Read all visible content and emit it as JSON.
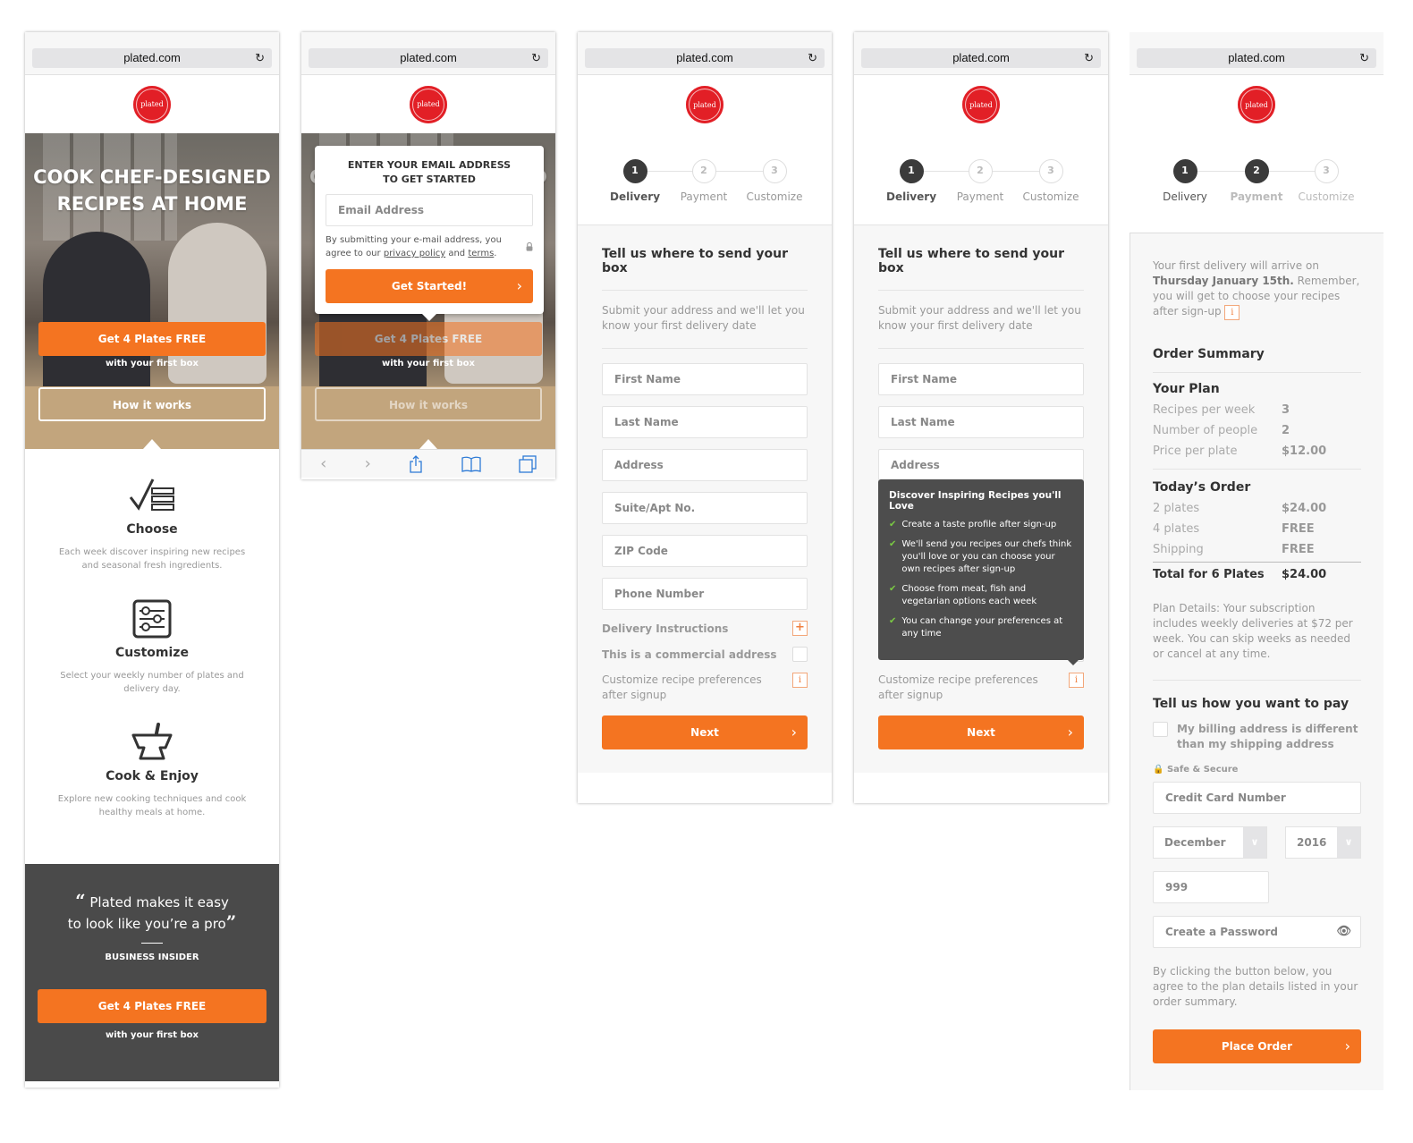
{
  "browser": {
    "url": "plated.com",
    "reload_icon": "↻"
  },
  "brand": {
    "logo_text": "plated",
    "accent": "#f47421",
    "logo_red": "#e21f26"
  },
  "landing": {
    "hero_title_line1": "COOK CHEF-DESIGNED",
    "hero_title_line2": "RECIPES AT HOME",
    "cta_label": "Get 4 Plates FREE",
    "cta_sub": "with your first box",
    "how_label": "How it works",
    "features": [
      {
        "title": "Choose",
        "desc": "Each week discover inspiring new recipes and seasonal fresh ingredients.",
        "icon": "checklist-icon"
      },
      {
        "title": "Customize",
        "desc": "Select your weekly number of plates and delivery day.",
        "icon": "sliders-icon"
      },
      {
        "title": "Cook & Enjoy",
        "desc": "Explore new cooking techniques and cook healthy meals at home.",
        "icon": "mortar-pestle-icon"
      }
    ],
    "quote_open": "“",
    "quote_line1": "Plated makes it easy",
    "quote_line2": "to look like you’re a pro",
    "quote_close": "”",
    "quote_source": "BUSINESS INSIDER",
    "footer_cta": "Get 4 Plates FREE",
    "footer_cta_sub": "with your first box"
  },
  "email_modal": {
    "heading_line1": "ENTER YOUR EMAIL ADDRESS",
    "heading_line2": "TO GET STARTED",
    "email_placeholder": "Email Address",
    "legal_prefix": "By submitting your e-mail address, you agree to our ",
    "privacy_link": "privacy policy",
    "legal_mid": " and ",
    "terms_link": "terms",
    "legal_suffix": ".",
    "submit_label": "Get Started!"
  },
  "safari_toolbar": {
    "back": "‹",
    "forward": "›",
    "share": "⇪",
    "bookmarks": "📖",
    "tabs": "⧉"
  },
  "steps": [
    {
      "num": "1",
      "label": "Delivery"
    },
    {
      "num": "2",
      "label": "Payment"
    },
    {
      "num": "3",
      "label": "Customize"
    }
  ],
  "delivery_form": {
    "title": "Tell us where to send your box",
    "subtitle": "Submit your address and we'll let you know your first delivery date",
    "fields": [
      "First Name",
      "Last Name",
      "Address",
      "Suite/Apt No.",
      "ZIP Code",
      "Phone Number"
    ],
    "delivery_instructions": "Delivery Instructions",
    "commercial_address": "This is a commercial address",
    "customize_note": "Customize recipe preferences after signup",
    "next_label": "Next"
  },
  "tooltip": {
    "title": "Discover Inspiring Recipes you'll Love",
    "items": [
      "Create a taste profile after sign-up",
      "We'll send you recipes our chefs think you'll love or you can choose your own recipes after sign-up",
      "Choose from meat, fish and vegetarian options each week",
      "You can change your preferences at any time"
    ]
  },
  "payment": {
    "intro_prefix": "Your first delivery will arrive on ",
    "intro_date": "Thursday January 15th.",
    "intro_suffix": " Remember, you will get to choose your recipes after sign-up",
    "order_summary_title": "Order Summary",
    "plan_title": "Your Plan",
    "plan": [
      {
        "k": "Recipes per week",
        "v": "3"
      },
      {
        "k": "Number of people",
        "v": "2"
      },
      {
        "k": "Price per plate",
        "v": "$12.00"
      }
    ],
    "today_title": "Today’s Order",
    "today": [
      {
        "k": "2 plates",
        "v": "$24.00"
      },
      {
        "k": "4 plates",
        "v": "FREE"
      },
      {
        "k": "Shipping",
        "v": "FREE"
      }
    ],
    "total_label": "Total for 6 Plates",
    "total_value": "$24.00",
    "plan_details": "Plan Details: Your subscription includes weekly deliveries at $72 per week. You can skip weeks as needed or cancel at any time.",
    "pay_title": "Tell us how you want to pay",
    "billing_label": "My billing address is different than my shipping address",
    "secure_label": "Safe & Secure",
    "card_placeholder": "Credit Card Number",
    "exp_month": "December",
    "exp_year": "2016",
    "cvv_value": "999",
    "password_placeholder": "Create a Password",
    "agree_text": "By clicking the button below, you agree to the plan details listed in your order summary.",
    "place_order_label": "Place Order"
  }
}
